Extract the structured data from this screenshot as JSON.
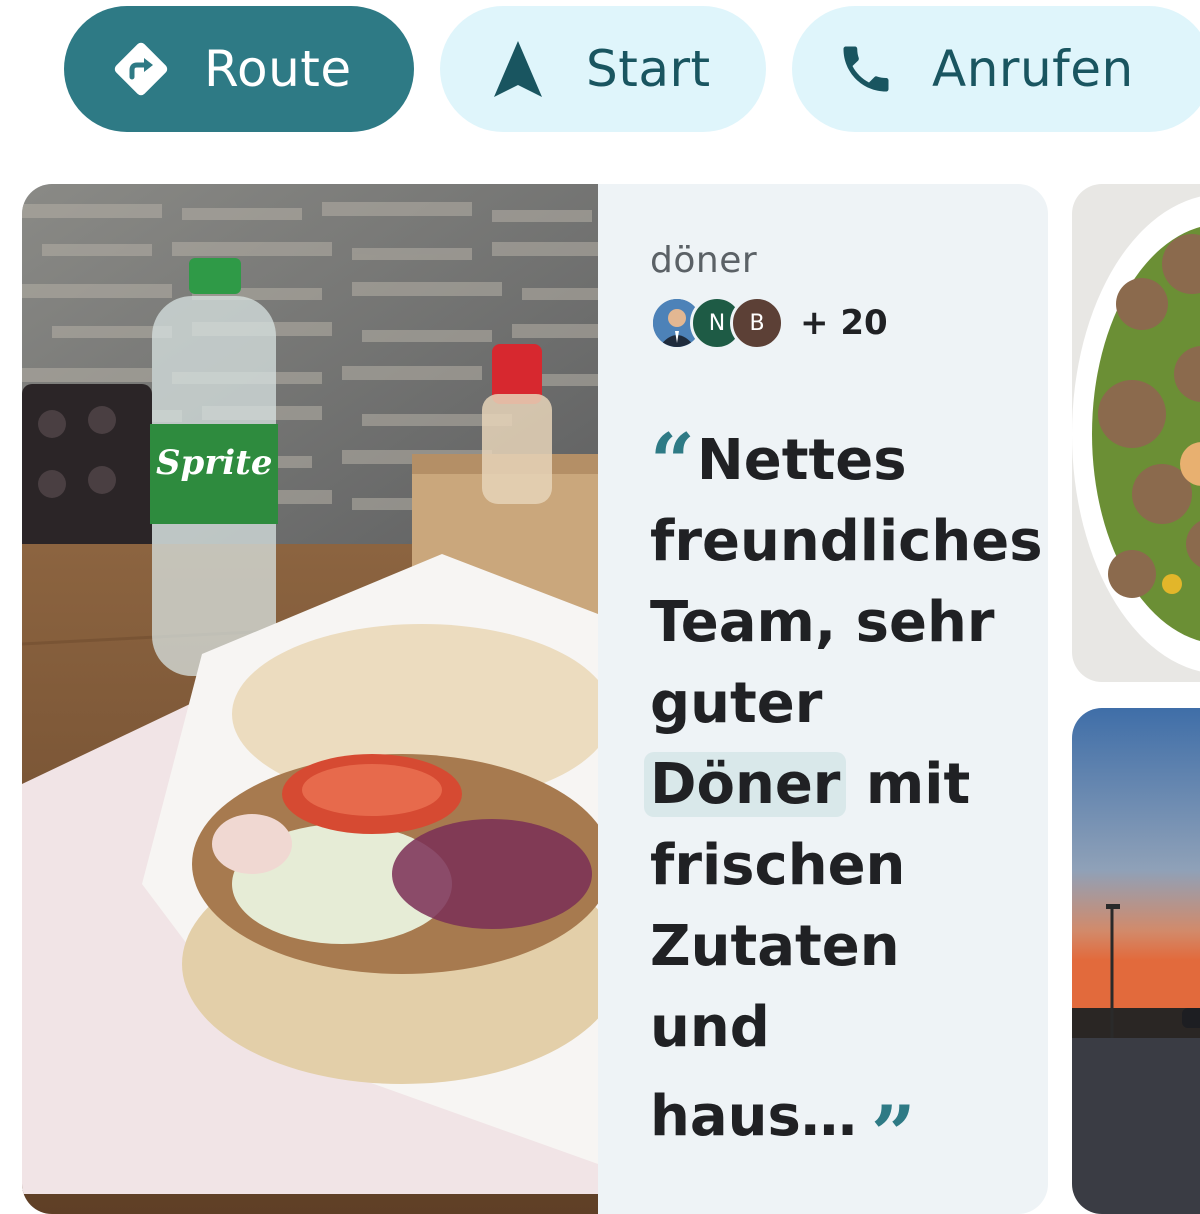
{
  "actions": {
    "route": {
      "label": "Route",
      "icon": "directions-icon"
    },
    "start": {
      "label": "Start",
      "icon": "navigation-arrow-icon"
    },
    "call": {
      "label": "Anrufen",
      "icon": "phone-icon"
    }
  },
  "review_card": {
    "dish": "döner",
    "avatars": [
      {
        "initial": "",
        "kind": "photo"
      },
      {
        "initial": "N"
      },
      {
        "initial": "B"
      }
    ],
    "more_count": "+ 20",
    "quote": {
      "open_mark": "“",
      "text_before": "Nettes freundliches Team, sehr guter",
      "highlight": "Döner",
      "text_after": "mit frischen Zutaten und haus…",
      "close_mark": "”"
    }
  },
  "colors": {
    "accent": "#2e7a85",
    "chip_secondary_bg": "#dff5fb",
    "card_bg": "#eef3f6",
    "text_primary": "#202124"
  }
}
